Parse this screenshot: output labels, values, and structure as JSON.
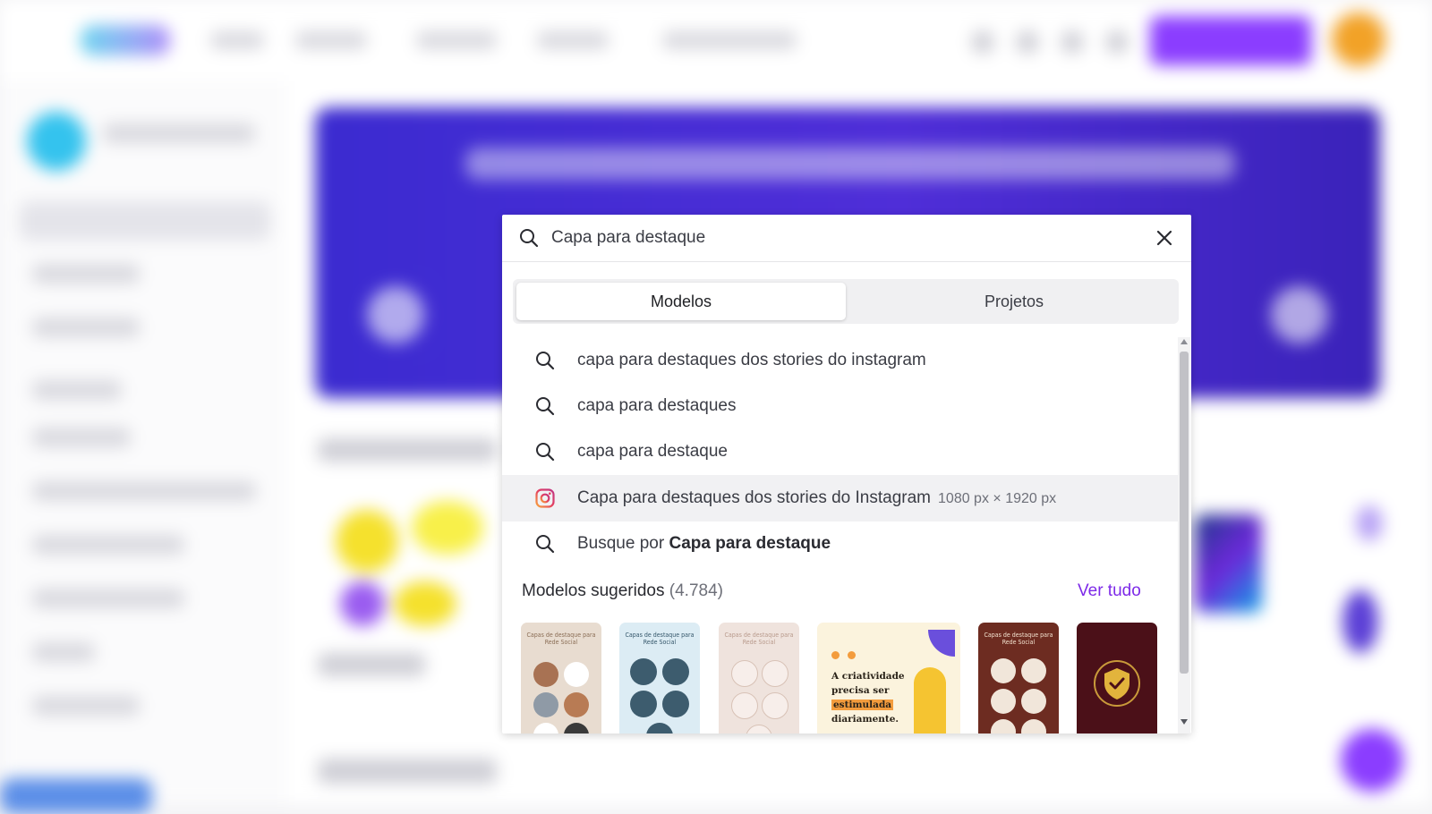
{
  "search": {
    "value": "Capa para destaque",
    "close_icon": "close-icon",
    "search_icon": "search-icon"
  },
  "tabs": [
    {
      "label": "Modelos",
      "active": true
    },
    {
      "label": "Projetos",
      "active": false
    }
  ],
  "suggestions": [
    {
      "icon": "search-icon",
      "text": "capa para destaques dos stories do instagram"
    },
    {
      "icon": "search-icon",
      "text": "capa para destaques"
    },
    {
      "icon": "search-icon",
      "text": "capa para destaque"
    },
    {
      "icon": "instagram-icon",
      "text": "Capa para destaques dos stories do Instagram",
      "dimensions": "1080 px × 1920 px",
      "highlighted": true
    },
    {
      "icon": "search-icon",
      "prefix": "Busque por ",
      "bold": "Capa para destaque"
    }
  ],
  "suggested_templates": {
    "title": "Modelos sugeridos",
    "count": "(4.784)",
    "see_all": "Ver tudo",
    "thumbnails": [
      {
        "caption": "Capas de destaque para Rede Social"
      },
      {
        "caption": "Capas de destaque para Rede Social"
      },
      {
        "caption": "Capas de destaque para Rede Social"
      },
      {
        "lines": [
          "A criatividade",
          "precisa ser",
          "estimulada",
          "diariamente."
        ]
      },
      {
        "caption": "Capas de destaque para Rede Social"
      },
      {
        "icon": "shield-check-icon"
      }
    ]
  },
  "colors": {
    "accent": "#7d2ae8",
    "instagram": "#e4405f",
    "hero": "#4f2ed8"
  }
}
